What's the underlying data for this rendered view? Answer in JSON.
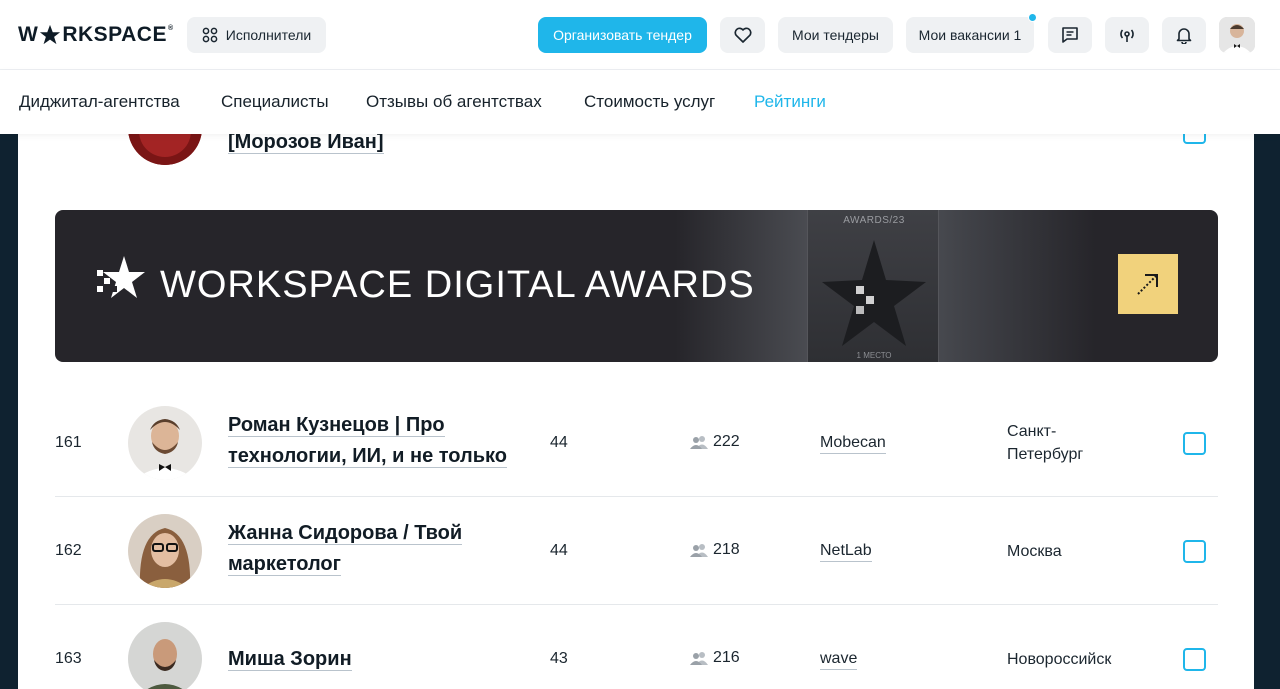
{
  "header": {
    "logo_text": "WORKSPACE",
    "executors_label": "Исполнители",
    "tender_label": "Организовать тендер",
    "my_tenders_label": "Мои тендеры",
    "my_vacancies_label": "Мои вакансии 1"
  },
  "nav": {
    "items": [
      {
        "label": "Диджитал-агентства"
      },
      {
        "label": "Специалисты"
      },
      {
        "label": "Отзывы об агентствах"
      },
      {
        "label": "Стоимость услуг"
      },
      {
        "label": "Рейтинги"
      }
    ]
  },
  "top_row": {
    "name": "[Морозов Иван]"
  },
  "banner": {
    "title": "WORKSPACE DIGITAL AWARDS",
    "trophy_top": "AWARDS/23",
    "trophy_bottom": "1 МЕСТО"
  },
  "rows": [
    {
      "rank": "161",
      "name_line1": "Роман Кузнецов | Про",
      "name_line2": "технологии, ИИ, и не только",
      "rating": "44",
      "subs": "222",
      "company": "Mobecan",
      "city_line1": "Санкт-",
      "city_line2": "Петербург"
    },
    {
      "rank": "162",
      "name_line1": "Жанна Сидорова / Твой",
      "name_line2": "маркетолог",
      "rating": "44",
      "subs": "218",
      "company": "NetLab",
      "city_line1": "Москва",
      "city_line2": ""
    },
    {
      "rank": "163",
      "name_line1": "Миша Зорин",
      "name_line2": "",
      "rating": "43",
      "subs": "216",
      "company": "wave",
      "city_line1": "Новороссийск",
      "city_line2": ""
    }
  ],
  "colors": {
    "accent": "#1fb6ea",
    "banner_bg": "#26252a",
    "banner_button": "#f1d27c"
  }
}
